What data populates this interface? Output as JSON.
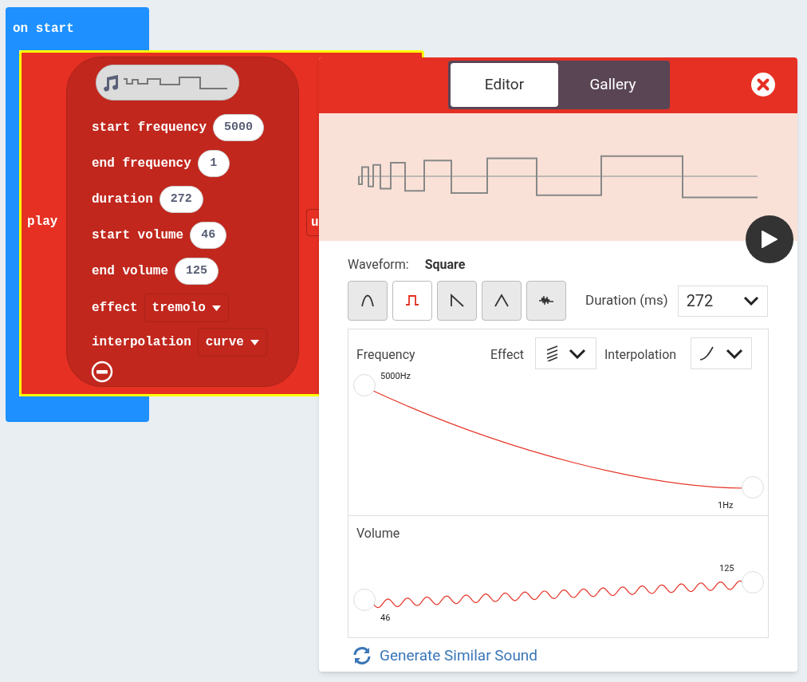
{
  "workspace": {
    "event_block": {
      "label": "on start"
    },
    "play_block": {
      "label": "play",
      "cut_field": "u",
      "params": [
        {
          "kind": "number",
          "label": "start frequency",
          "value": "5000"
        },
        {
          "kind": "number",
          "label": "end frequency",
          "value": "1"
        },
        {
          "kind": "number",
          "label": "duration",
          "value": "272"
        },
        {
          "kind": "number",
          "label": "start volume",
          "value": "46"
        },
        {
          "kind": "number",
          "label": "end volume",
          "value": "125"
        },
        {
          "kind": "dropdown",
          "label": "effect",
          "value": "tremolo"
        },
        {
          "kind": "dropdown",
          "label": "interpolation",
          "value": "curve"
        }
      ]
    }
  },
  "sound_editor": {
    "tabs": [
      {
        "label": "Editor",
        "selected": true
      },
      {
        "label": "Gallery",
        "selected": false
      }
    ],
    "waveform_label": "Waveform:",
    "waveform_value": "Square",
    "waveforms": [
      {
        "kind": "sine",
        "selected": false
      },
      {
        "kind": "square",
        "selected": true
      },
      {
        "kind": "sawtooth",
        "selected": false
      },
      {
        "kind": "triangle",
        "selected": false
      },
      {
        "kind": "noise",
        "selected": false
      }
    ],
    "duration_label": "Duration (ms)",
    "duration_value": "272",
    "frequency": {
      "label": "Frequency",
      "start": "5000Hz",
      "end": "1Hz"
    },
    "effect_label": "Effect",
    "interpolation_label": "Interpolation",
    "volume": {
      "label": "Volume",
      "start": "46",
      "end": "125"
    },
    "generate_link": "Generate Similar Sound"
  }
}
